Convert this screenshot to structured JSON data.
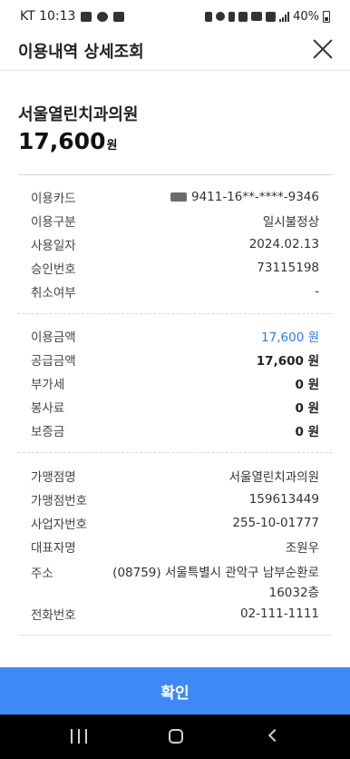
{
  "status_bar": {
    "time": "KT 10:13",
    "battery_text": "40%",
    "left_icons": [
      "gallery-icon",
      "chat-icon",
      "talk-icon"
    ],
    "right_icons": [
      "nfc-icon",
      "alarm-icon",
      "bluetooth-icon",
      "mute-icon",
      "hd-icon",
      "5g-icon",
      "signal-icon",
      "battery-icon"
    ]
  },
  "header": {
    "title": "이용내역 상세조회",
    "close_icon": "close-icon"
  },
  "summary": {
    "merchant": "서울열린치과의원",
    "amount": "17,600",
    "unit": "원"
  },
  "details": {
    "card_label": "이용카드",
    "card_value": "9411-16**-****-9346",
    "type_label": "이용구분",
    "type_value": "일시불정상",
    "date_label": "사용일자",
    "date_value": "2024.02.13",
    "approval_label": "승인번호",
    "approval_value": "73115198",
    "cancel_label": "취소여부",
    "cancel_value": "-"
  },
  "amounts": {
    "usage_label": "이용금액",
    "usage_value": "17,600 원",
    "supply_label": "공급금액",
    "supply_value": "17,600 원",
    "vat_label": "부가세",
    "vat_value": "0 원",
    "service_label": "봉사료",
    "service_value": "0 원",
    "deposit_label": "보증금",
    "deposit_value": "0 원"
  },
  "merchant_info": {
    "name_label": "가맹점명",
    "name_value": "서울열린치과의원",
    "number_label": "가맹점번호",
    "number_value": "159613449",
    "biz_label": "사업자번호",
    "biz_value": "255-10-01777",
    "ceo_label": "대표자명",
    "ceo_value": "조원우",
    "addr_label": "주소",
    "addr_value": "(08759) 서울특별시 관악구 남부순환로 16032층",
    "phone_label": "전화번호",
    "phone_value": "02-111-1111"
  },
  "footer": {
    "confirm_label": "확인"
  },
  "colors": {
    "accent": "#3d8af7",
    "amount_blue": "#2e7be8"
  }
}
